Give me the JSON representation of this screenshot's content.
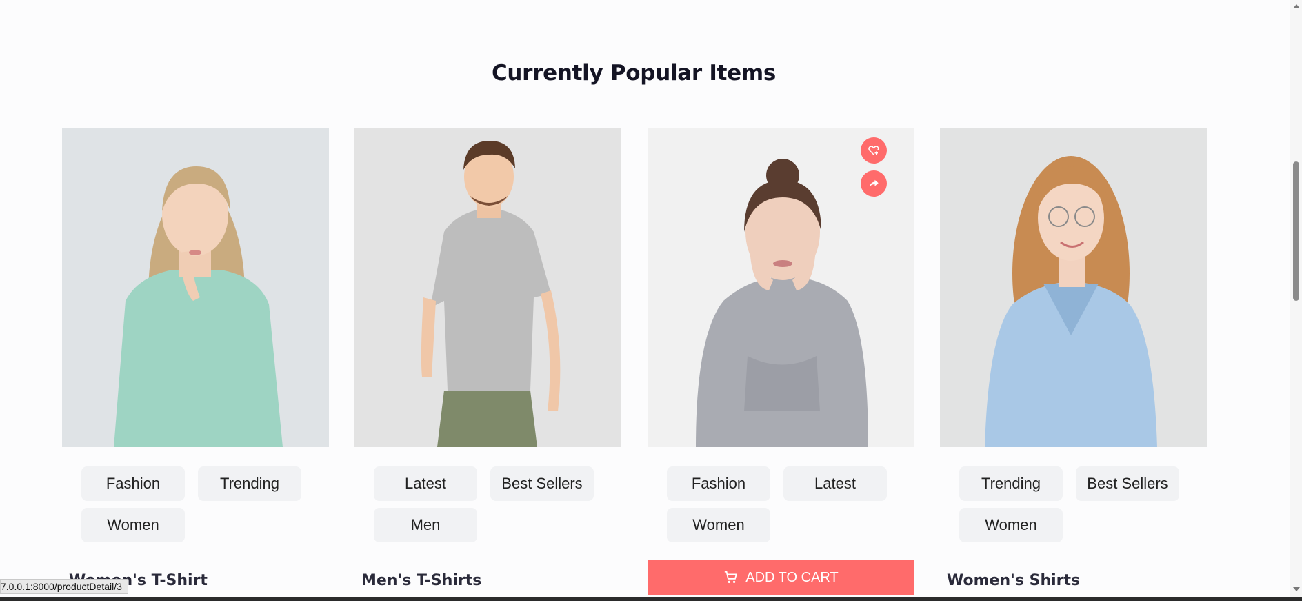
{
  "section": {
    "title": "Currently Popular Items"
  },
  "products": [
    {
      "tags": [
        "Fashion",
        "Trending",
        "Women"
      ],
      "name": "Women's T-Shirt",
      "image": "woman-mint-sweater"
    },
    {
      "tags": [
        "Latest",
        "Best Sellers",
        "Men"
      ],
      "name": "Men's T-Shirts",
      "image": "man-grey-tshirt"
    },
    {
      "tags": [
        "Fashion",
        "Latest",
        "Women"
      ],
      "name": "",
      "image": "woman-grey-hoodie",
      "cart_label": "ADD TO CART",
      "icons": [
        "heart-plus-icon",
        "share-icon"
      ]
    },
    {
      "tags": [
        "Trending",
        "Best Sellers",
        "Women"
      ],
      "name": "Women's Shirts",
      "image": "woman-blue-shirt"
    }
  ],
  "status_bar": {
    "url": "7.0.0.1:8000/productDetail/3"
  },
  "colors": {
    "accent": "#ff6b6b",
    "tag_bg": "#f1f2f4",
    "title": "#141424"
  }
}
